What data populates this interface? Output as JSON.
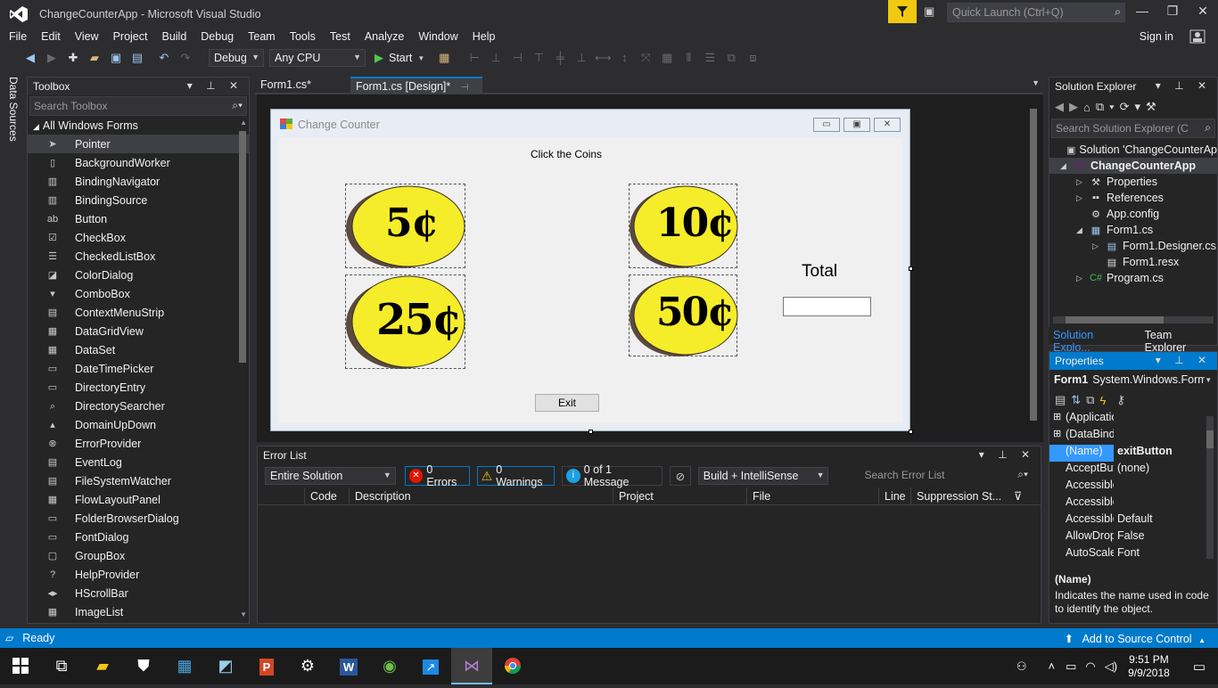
{
  "window": {
    "title": "ChangeCounterApp - Microsoft Visual Studio",
    "quick_launch_placeholder": "Quick Launch (Ctrl+Q)"
  },
  "menu": [
    "File",
    "Edit",
    "View",
    "Project",
    "Build",
    "Debug",
    "Team",
    "Tools",
    "Test",
    "Analyze",
    "Window",
    "Help"
  ],
  "signin": "Sign in",
  "toolbar": {
    "config": "Debug",
    "platform": "Any CPU",
    "start_label": "Start"
  },
  "left_strip": "Data Sources",
  "toolbox": {
    "title": "Toolbox",
    "search_placeholder": "Search Toolbox",
    "group": "All Windows Forms",
    "items": [
      "Pointer",
      "BackgroundWorker",
      "BindingNavigator",
      "BindingSource",
      "Button",
      "CheckBox",
      "CheckedListBox",
      "ColorDialog",
      "ComboBox",
      "ContextMenuStrip",
      "DataGridView",
      "DataSet",
      "DateTimePicker",
      "DirectoryEntry",
      "DirectorySearcher",
      "DomainUpDown",
      "ErrorProvider",
      "EventLog",
      "FileSystemWatcher",
      "FlowLayoutPanel",
      "FolderBrowserDialog",
      "FontDialog",
      "GroupBox",
      "HelpProvider",
      "HScrollBar",
      "ImageList"
    ]
  },
  "doc_tabs": [
    {
      "label": "Form1.cs*"
    },
    {
      "label": "Form1.cs [Design]*"
    }
  ],
  "form": {
    "title": "Change Counter",
    "heading": "Click the Coins",
    "coins": [
      "5¢",
      "10¢",
      "25¢",
      "50¢"
    ],
    "total_label": "Total",
    "total_value": "",
    "exit_label": "Exit"
  },
  "error_list": {
    "title": "Error List",
    "scope": "Entire Solution",
    "errors": "0 Errors",
    "warnings": "0 Warnings",
    "messages": "0 of 1 Message",
    "build_filter": "Build + IntelliSense",
    "search_placeholder": "Search Error List",
    "columns": [
      "Code",
      "Description",
      "Project",
      "File",
      "Line",
      "Suppression St..."
    ]
  },
  "solution_explorer": {
    "title": "Solution Explorer",
    "search_placeholder": "Search Solution Explorer (C",
    "items": [
      {
        "label": "Solution 'ChangeCounterAp",
        "depth": 0,
        "expander": ""
      },
      {
        "label": "ChangeCounterApp",
        "depth": 0,
        "expander": "◢"
      },
      {
        "label": "Properties",
        "depth": 1,
        "expander": "▷"
      },
      {
        "label": "References",
        "depth": 1,
        "expander": "▷"
      },
      {
        "label": "App.config",
        "depth": 1,
        "expander": ""
      },
      {
        "label": "Form1.cs",
        "depth": 1,
        "expander": "◢"
      },
      {
        "label": "Form1.Designer.cs",
        "depth": 2,
        "expander": "▷"
      },
      {
        "label": "Form1.resx",
        "depth": 2,
        "expander": ""
      },
      {
        "label": "Program.cs",
        "depth": 1,
        "expander": "▷"
      }
    ],
    "tabs": [
      "Solution Explo...",
      "Team Explorer"
    ]
  },
  "properties": {
    "title": "Properties",
    "object": "Form1",
    "object_type": "System.Windows.Form",
    "rows": [
      {
        "key": "(Application",
        "value": "",
        "expander": "⊞"
      },
      {
        "key": "(DataBinding",
        "value": "",
        "expander": "⊞"
      },
      {
        "key": "(Name)",
        "value": "exitButton",
        "selected": true
      },
      {
        "key": "AcceptButto",
        "value": "(none)"
      },
      {
        "key": "AccessibleDe",
        "value": ""
      },
      {
        "key": "AccessibleNa",
        "value": ""
      },
      {
        "key": "AccessibleRo",
        "value": "Default"
      },
      {
        "key": "AllowDrop",
        "value": "False"
      },
      {
        "key": "AutoScaleMc",
        "value": "Font"
      }
    ],
    "desc_title": "(Name)",
    "desc_text": "Indicates the name used in code to identify the object."
  },
  "status": {
    "left": "Ready",
    "right": "Add to Source Control"
  },
  "taskbar": {
    "time": "9:51 PM",
    "date": "9/9/2018"
  },
  "colors": {
    "accent": "#007acc",
    "coin_fill": "#f5ec2a",
    "coin_shadow": "#5b4a3e",
    "filter_yellow": "#f2c811"
  }
}
